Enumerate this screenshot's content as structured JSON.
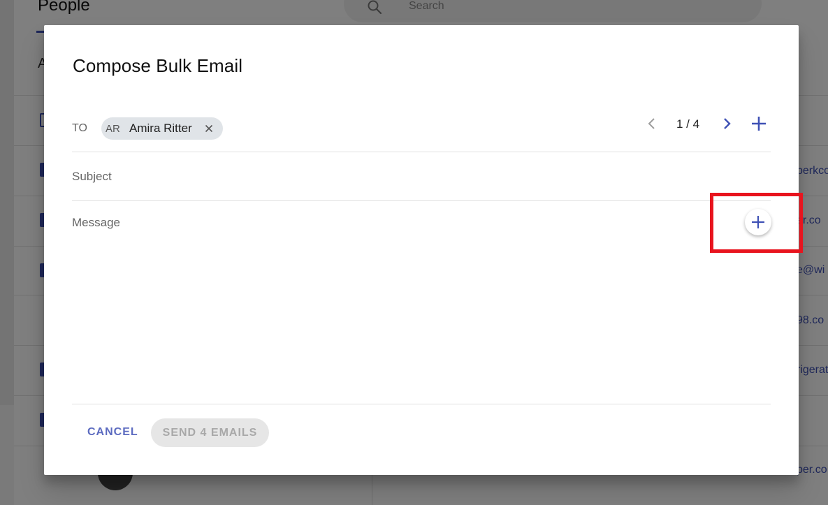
{
  "background": {
    "page_title": "People",
    "search_placeholder": "Search",
    "section_letter": "A",
    "email_fragments": [
      "perkco",
      "er.co",
      "e@wi",
      "98.co",
      "rigerat",
      "per.co"
    ]
  },
  "dialog": {
    "title": "Compose Bulk Email",
    "to_label": "TO",
    "recipient": {
      "initials": "AR",
      "name": "Amira Ritter"
    },
    "pager": {
      "count": "1 / 4"
    },
    "subject_placeholder": "Subject",
    "message_placeholder": "Message",
    "cancel_label": "CANCEL",
    "send_label": "SEND 4 EMAILS"
  },
  "colors": {
    "accent": "#3f51b5",
    "cancel_text": "#5c6bc0",
    "highlight": "#e8141e",
    "disabled_bg": "#e6e6e6",
    "disabled_text": "#a8a8a8"
  },
  "icons": {
    "chip_close": "close-icon",
    "prev": "chevron-left-icon",
    "next": "chevron-right-icon",
    "add_recipient": "plus-icon",
    "message_add": "plus-icon",
    "search": "search-icon"
  }
}
